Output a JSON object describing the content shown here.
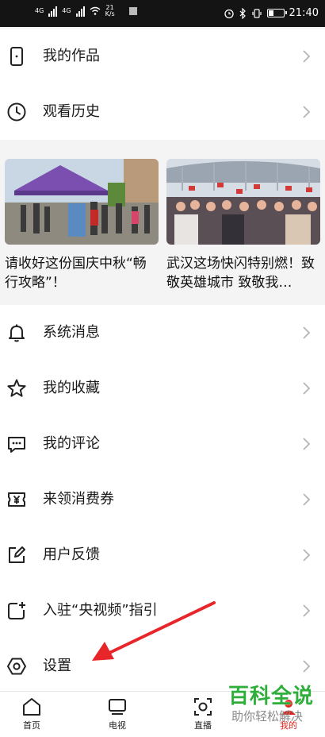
{
  "status_bar": {
    "network_left": "4G",
    "network_right": "4G",
    "speed_value": "21",
    "speed_unit": "K/s",
    "time": "21:40",
    "battery_level": 0.4
  },
  "menu_top": [
    {
      "label": "我的作品",
      "icon": "phone-icon"
    },
    {
      "label": "观看历史",
      "icon": "clock-icon"
    }
  ],
  "news_cards": [
    {
      "title": "请收好这份国庆中秋“畅行攻略”！"
    },
    {
      "title": "武汉这场快闪特别燃！致敬英雄城市 致敬我…"
    }
  ],
  "menu_bottom": [
    {
      "label": "系统消息",
      "icon": "bell-icon"
    },
    {
      "label": "我的收藏",
      "icon": "star-icon"
    },
    {
      "label": "我的评论",
      "icon": "comment-icon"
    },
    {
      "label": "来领消费券",
      "icon": "coupon-icon"
    },
    {
      "label": "用户反馈",
      "icon": "edit-icon"
    },
    {
      "label": "入驻“央视频”指引",
      "icon": "join-icon"
    },
    {
      "label": "设置",
      "icon": "settings-icon"
    }
  ],
  "bottom_nav": [
    {
      "label": "首页",
      "icon": "home-icon"
    },
    {
      "label": "电视",
      "icon": "tv-icon"
    },
    {
      "label": "直播",
      "icon": "live-icon"
    },
    {
      "label": "我的",
      "icon": "me-icon",
      "active": true
    }
  ],
  "watermark": {
    "line1": "百科全说",
    "line2": "助你轻松解决"
  },
  "colors": {
    "accent_red": "#e0231d",
    "watermark_green": "#2eae3a",
    "annotation_arrow": "#e8262a"
  }
}
